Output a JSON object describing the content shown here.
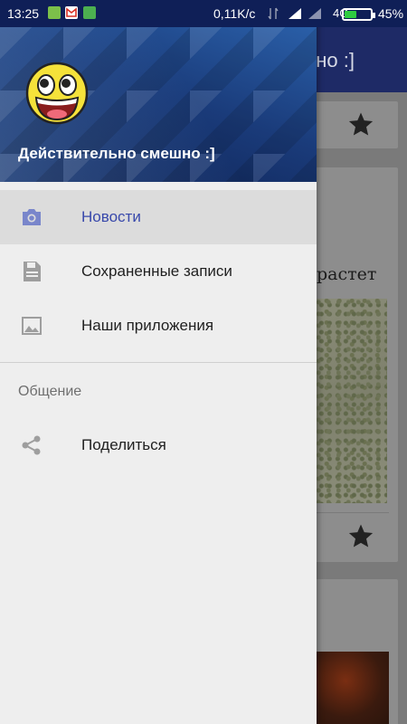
{
  "status_bar": {
    "time": "13:25",
    "speed": "0,11K/c",
    "network": "4G",
    "battery_percent": "45%",
    "battery_level": 0.45
  },
  "drawer": {
    "header_title": "Действительно смешно :]",
    "items": [
      {
        "label": "Новости",
        "icon": "camera-icon",
        "active": true
      },
      {
        "label": "Сохраненные записи",
        "icon": "save-icon",
        "active": false
      },
      {
        "label": "Наши приложения",
        "icon": "image-icon",
        "active": false
      }
    ],
    "section_title": "Общение",
    "section_items": [
      {
        "label": "Поделиться",
        "icon": "share-icon"
      }
    ]
  },
  "background_app": {
    "toolbar_title_partial": "но :]",
    "card_text_partial": "растет"
  },
  "colors": {
    "accent": "#3949ab",
    "toolbar": "#1e2a66",
    "status_bar": "#0f1f57"
  }
}
